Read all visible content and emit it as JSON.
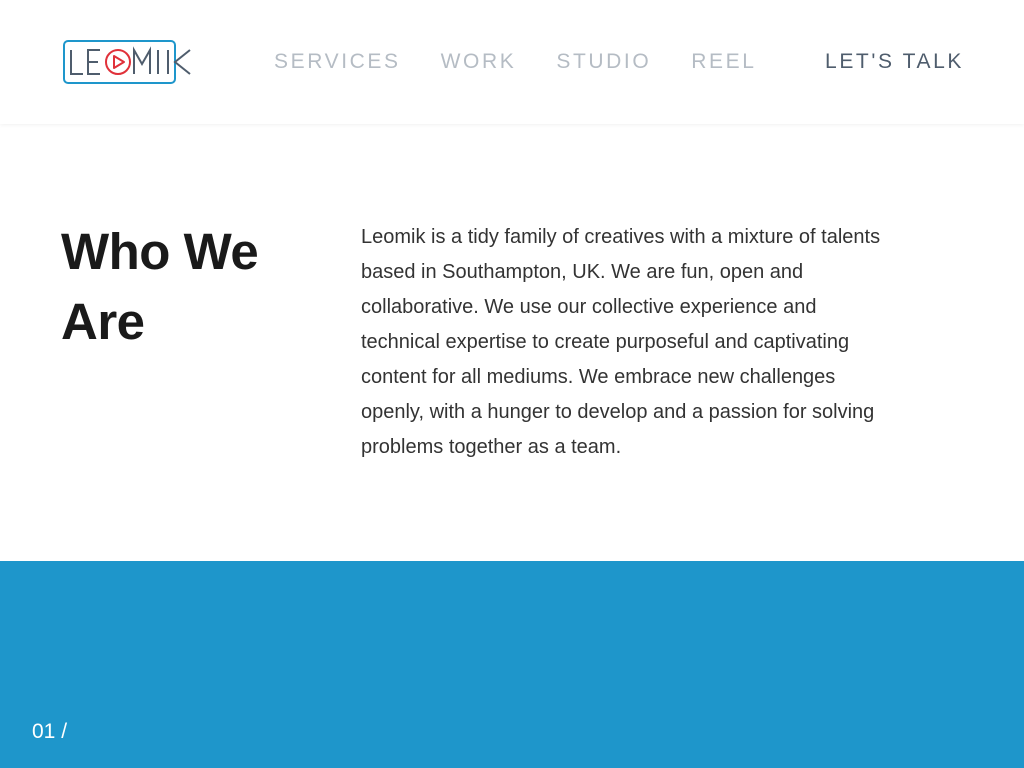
{
  "brand": {
    "logo_text": "LEOMIK",
    "logo_border_color": "#1e96cb",
    "logo_text_color": "#4f5d6d",
    "logo_play_color": "#e0313a"
  },
  "nav": {
    "items": [
      {
        "label": "SERVICES"
      },
      {
        "label": "WORK"
      },
      {
        "label": "STUDIO"
      },
      {
        "label": "REEL"
      }
    ],
    "cta_label": "LET'S TALK"
  },
  "about": {
    "title": "Who We Are",
    "body": "Leomik is a tidy family of creatives with a mixture of talents based in Southampton, UK. We are fun, open and collaborative. We use our collective experience and technical expertise to create purposeful and captivating content for all mediums. We embrace new challenges openly, with a hunger to develop and a passion for solving problems together as a team."
  },
  "section": {
    "counter": "01 /",
    "background_color": "#1e96cb"
  }
}
